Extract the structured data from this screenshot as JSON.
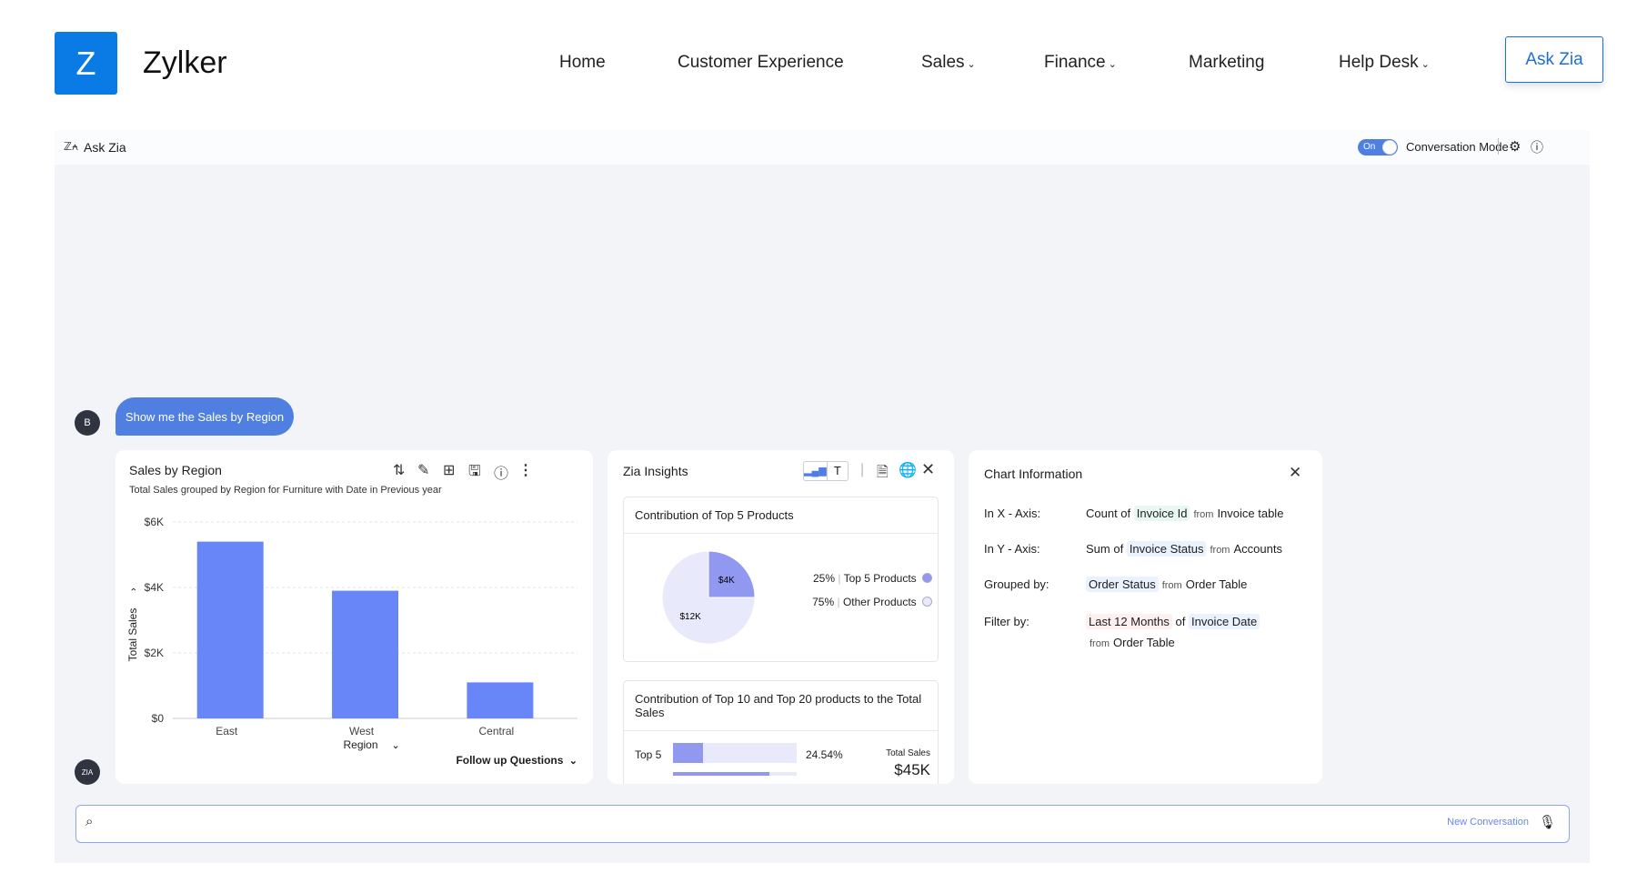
{
  "header": {
    "logo_letter": "Z",
    "brand": "Zylker",
    "nav": [
      {
        "label": "Home",
        "dropdown": false
      },
      {
        "label": "Customer Experience",
        "dropdown": false
      },
      {
        "label": "Sales",
        "dropdown": true
      },
      {
        "label": "Finance",
        "dropdown": true
      },
      {
        "label": "Marketing",
        "dropdown": false
      },
      {
        "label": "Help Desk",
        "dropdown": true
      }
    ],
    "ask_zia": "Ask Zia"
  },
  "panel": {
    "title": "Ask Zia",
    "toggle_label": "On",
    "toggle_on": true,
    "conversation_mode": "Conversation Mode"
  },
  "chat": {
    "user_avatar": "B",
    "user_message": "Show me the Sales by Region",
    "zia_avatar": "ZIA"
  },
  "chart_card": {
    "title": "Sales by Region",
    "subtitle": "Total Sales grouped by Region for Furniture with Date in Previous year",
    "follow_up": "Follow up Questions"
  },
  "chart_data": {
    "type": "bar",
    "categories": [
      "East",
      "West",
      "Central"
    ],
    "values": [
      5400,
      3900,
      1100
    ],
    "xlabel": "Region",
    "ylabel": "Total Sales",
    "ylim": [
      0,
      6000
    ],
    "yticks": [
      "$0",
      "$2K",
      "$4K",
      "$6K"
    ],
    "grid": true,
    "color": "#6886f8"
  },
  "insights": {
    "title": "Zia Insights",
    "box1": {
      "title": "Contribution of Top 5 Products",
      "slices": [
        {
          "label": "Top 5 Products",
          "pct": "25%",
          "value": "$4K",
          "fraction": 0.25,
          "color": "#9099ef"
        },
        {
          "label": "Other Products",
          "pct": "75%",
          "value": "$12K",
          "fraction": 0.75,
          "color": "#e8e9fb"
        }
      ]
    },
    "box2": {
      "title": "Contribution of Top 10 and Top 20 products to the Total Sales",
      "row_label": "Top 5",
      "row_pct": "24.54%",
      "row_fraction": 0.2454,
      "total_label": "Total Sales",
      "total_value": "$45K"
    }
  },
  "chart_info": {
    "title": "Chart Information",
    "rows": [
      {
        "label": "In X - Axis:",
        "pre": "Count of",
        "field": "Invoice Id",
        "from": "from",
        "table": "Invoice table",
        "bg": "#e9f7f2"
      },
      {
        "label": "In Y - Axis:",
        "pre": "Sum of",
        "field": "Invoice Status",
        "from": "from",
        "table": "Accounts",
        "bg": "#eaf3fd"
      },
      {
        "label": "Grouped by:",
        "pre": "",
        "field": "Order Status",
        "from": "from",
        "table": "Order Table",
        "bg": "#eaf3fd"
      }
    ],
    "filter": {
      "label": "Filter by:",
      "range": "Last 12 Months",
      "of": "of",
      "field": "Invoice Date",
      "from": "from",
      "table": "Order Table"
    }
  },
  "search": {
    "value": "",
    "new_conversation": "New Conversation"
  }
}
